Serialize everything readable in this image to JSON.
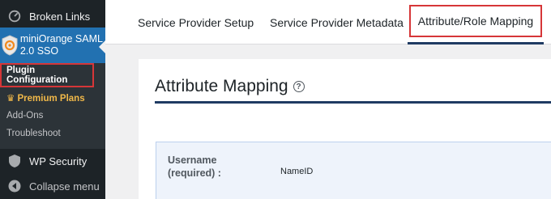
{
  "sidebar": {
    "broken_links": "Broken Links",
    "plugin": "miniOrange SAML 2.0 SSO",
    "submenu": {
      "active": "Plugin Configuration",
      "premium": "Premium Plans",
      "addons": "Add-Ons",
      "troubleshoot": "Troubleshoot"
    },
    "wp_security": "WP Security",
    "collapse": "Collapse menu"
  },
  "tabs": [
    {
      "label": "Service Provider Setup"
    },
    {
      "label": "Service Provider Metadata"
    },
    {
      "label": "Attribute/Role Mapping"
    }
  ],
  "card": {
    "title": "Attribute Mapping",
    "help_glyph": "?",
    "row": {
      "label": "Username (required) :",
      "value": "NameID"
    }
  },
  "colors": {
    "accent": "#2271b1",
    "highlight": "#d63638",
    "underline": "#1f3b63",
    "premium": "#f0b849"
  }
}
